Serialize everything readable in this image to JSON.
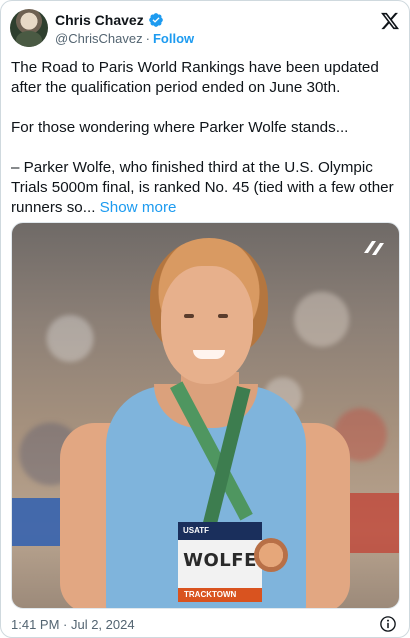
{
  "author": {
    "name": "Chris Chavez",
    "handle": "@ChrisChavez",
    "separator": "·",
    "follow_label": "Follow",
    "verified_color": "#1d9bf0"
  },
  "tweet": {
    "paragraphs": [
      "The Road to Paris World Rankings have been updated after the qualification period ended on June 30th.",
      "For those wondering where Parker Wolfe stands..."
    ],
    "truncated_text": "– Parker Wolfe, who finished third at the U.S. Olympic Trials 5000m final, is ranked No. 45 (tied with a few other runners so...",
    "show_more_label": "Show more"
  },
  "media": {
    "bib_top": "USATF",
    "bib_name": "WOLFE",
    "bib_bottom": "TRACKTOWN"
  },
  "footer": {
    "timestamp": "1:41 PM · Jul 2, 2024"
  },
  "icons": {
    "platform": "x-logo-icon",
    "verified": "verified-badge-icon",
    "info": "info-icon"
  },
  "colors": {
    "link": "#1d9bf0",
    "text": "#0f1419",
    "muted": "#536471"
  }
}
